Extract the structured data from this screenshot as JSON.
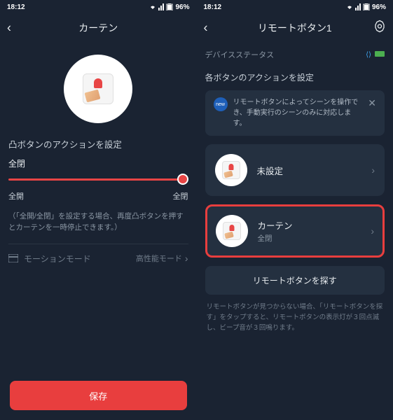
{
  "statusBar": {
    "time": "18:12",
    "battery": "96%"
  },
  "left": {
    "title": "カーテン",
    "sectionTitle": "凸ボタンのアクションを設定",
    "sliderValue": "全閉",
    "sliderMin": "全開",
    "sliderMax": "全閉",
    "hint": "（「全開/全閉」を設定する場合、再度凸ボタンを押すとカーテンを一時停止できます。）",
    "motionLabel": "モーションモード",
    "motionValue": "高性能モード",
    "saveLabel": "保存"
  },
  "right": {
    "title": "リモートボタン1",
    "deviceStatusLabel": "デバイスステータス",
    "sectionTitle": "各ボタンのアクションを設定",
    "infoBadge": "new",
    "infoText": "リモートボタンによってシーンを操作でき、手動実行のシーンのみに対応します。",
    "cards": [
      {
        "title": "未設定",
        "sub": ""
      },
      {
        "title": "カーテン",
        "sub": "全閉"
      }
    ],
    "findButton": "リモートボタンを探す",
    "helpText": "リモートボタンが見つからない場合、「リモートボタンを探す」をタップすると、リモートボタンの表示灯が３回点滅し、ビープ音が３回鳴ります。"
  }
}
